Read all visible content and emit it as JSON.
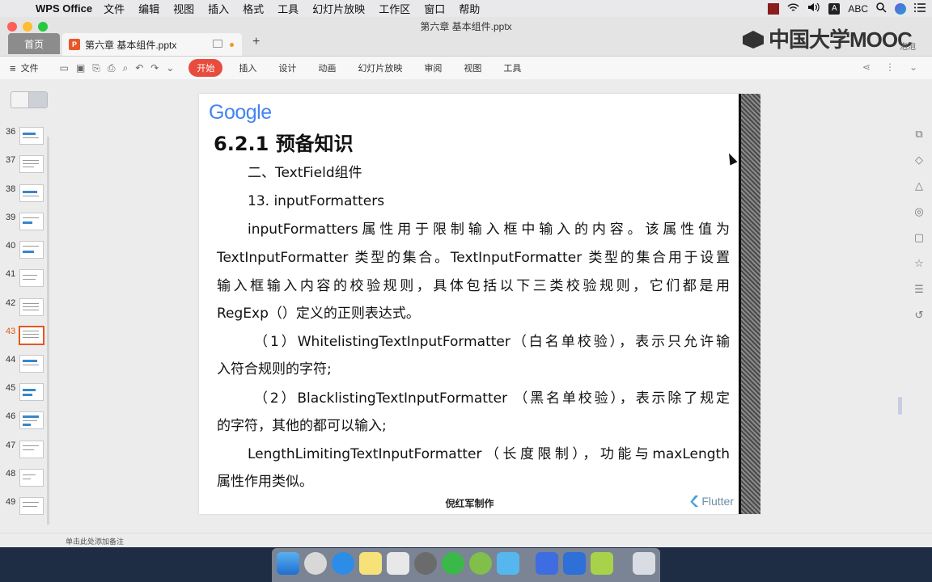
{
  "menubar": {
    "app_name": "WPS Office",
    "items": [
      "文件",
      "编辑",
      "视图",
      "插入",
      "格式",
      "工具",
      "幻灯片放映",
      "工作区",
      "窗口",
      "帮助"
    ],
    "input_method": "ABC"
  },
  "window": {
    "doc_title": "第六章 基本组件.pptx",
    "home_tab": "首页",
    "doc_tab": "第六章 基本组件.pptx",
    "add_tab": "+",
    "watermark": "中国大学MOOC",
    "user_label": "泡泡"
  },
  "toolbar": {
    "file_label": "文件",
    "tabs": [
      {
        "label": "开始",
        "active": true
      },
      {
        "label": "插入",
        "active": false
      },
      {
        "label": "设计",
        "active": false
      },
      {
        "label": "动画",
        "active": false
      },
      {
        "label": "幻灯片放映",
        "active": false
      },
      {
        "label": "审阅",
        "active": false
      },
      {
        "label": "视图",
        "active": false
      },
      {
        "label": "工具",
        "active": false
      }
    ]
  },
  "thumbnails": {
    "slides": [
      "36",
      "37",
      "38",
      "39",
      "40",
      "41",
      "42",
      "43",
      "44",
      "45",
      "46",
      "47",
      "48",
      "49"
    ],
    "active": "43",
    "add_label": "+"
  },
  "slide": {
    "logo": "Google",
    "title": "6.2.1  预备知识",
    "lines": [
      "二、TextField组件",
      "13. inputFormatters",
      "inputFormatters属性用于限制输入框中输入的内容。该属性值为",
      "TextInputFormatter 类型的集合。TextInputFormatter 类型的集合用于设置",
      "输入框输入内容的校验规则，具体包括以下三类校验规则，它们都是用",
      "RegExp（）定义的正则表达式。",
      "（1）WhitelistingTextInputFormatter（白名单校验），表示只允许输",
      "入符合规则的字符;",
      "（2）BlacklistingTextInputFormatter （黑名单校验），表示除了规定",
      "的字符，其他的都可以输入;",
      "LengthLimitingTextInputFormatter（长度限制），功能与maxLength",
      "属性作用类似。"
    ],
    "footer": "倪红军制作",
    "flutter_label": "Flutter"
  },
  "notes": {
    "placeholder": "单击此处添加备注"
  },
  "colors": {
    "accent": "#e84c3d",
    "active_thumb": "#e4571f"
  }
}
